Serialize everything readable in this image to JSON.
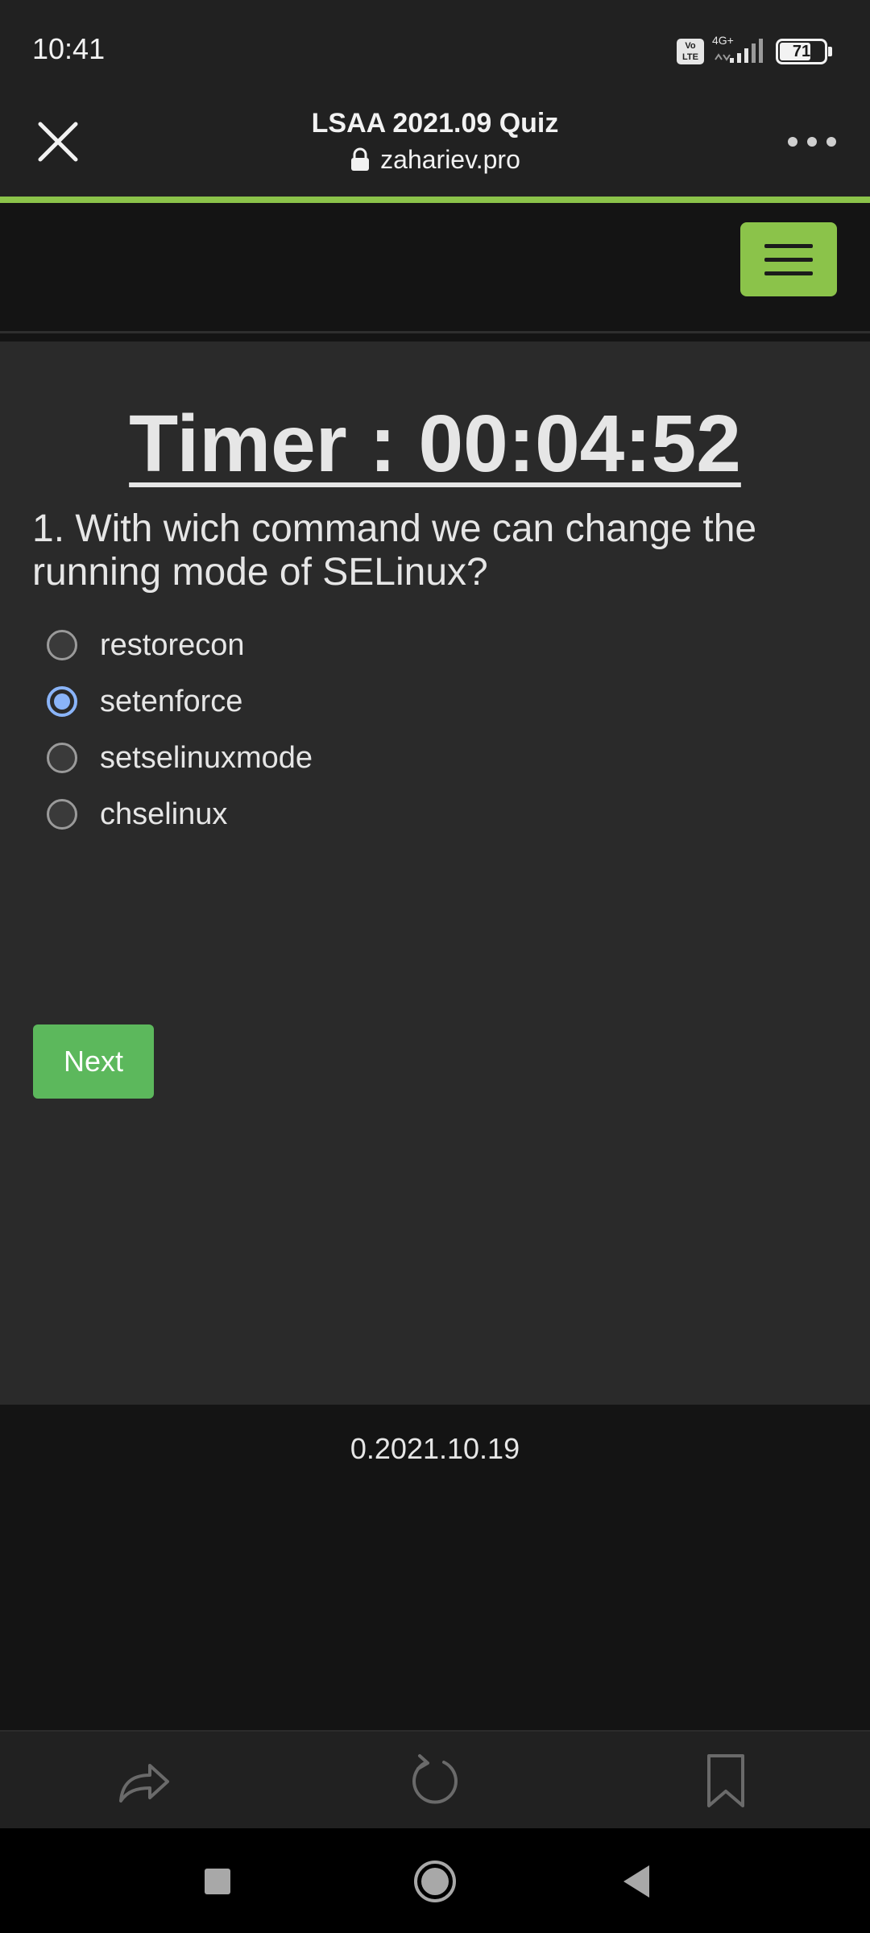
{
  "status_bar": {
    "time": "10:41",
    "volte_line1": "Vo",
    "volte_line2": "LTE",
    "network": "4G+",
    "battery": "71",
    "battery_level": 0.71
  },
  "browser": {
    "title": "LSAA 2021.09 Quiz",
    "url": "zahariev.pro",
    "progress_color": "#8bc34a"
  },
  "site": {
    "menu_button_color": "#8bc34a"
  },
  "quiz": {
    "timer": "Timer : 00:04:52",
    "question": "1. With wich command we can change the running mode of SELinux?",
    "options": [
      {
        "label": "restorecon",
        "selected": false
      },
      {
        "label": "setenforce",
        "selected": true
      },
      {
        "label": "setselinuxmode",
        "selected": false
      },
      {
        "label": "chselinux",
        "selected": false
      }
    ],
    "next_label": "Next",
    "next_color": "#5cb85c"
  },
  "footer": {
    "version": "0.2021.10.19"
  },
  "toolbar": {
    "icons": [
      "share-icon",
      "reload-icon",
      "bookmark-icon"
    ]
  },
  "system_nav": {
    "icons": [
      "recents-icon",
      "home-icon",
      "back-icon"
    ]
  }
}
